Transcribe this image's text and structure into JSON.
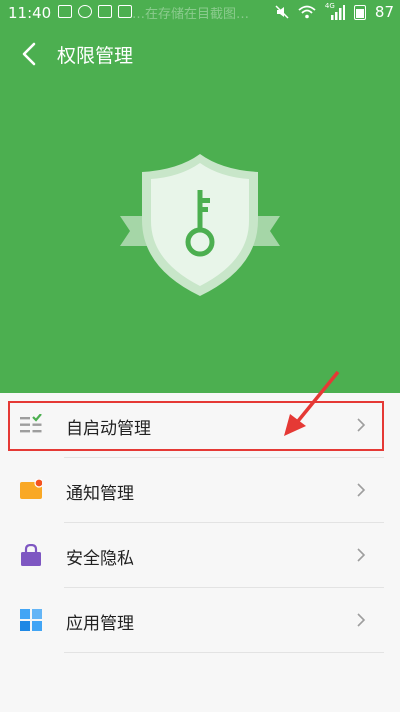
{
  "status_bar": {
    "time": "11:40",
    "ghost_text": "…在存储在目截图…",
    "network": "4G",
    "battery": "87"
  },
  "header": {
    "title": "权限管理",
    "back_icon": "chevron-left-icon"
  },
  "hero": {
    "background_color": "#4caf50",
    "emblem": "shield-key-icon"
  },
  "menu": {
    "items": [
      {
        "label": "自启动管理",
        "icon": "startup-list-icon",
        "highlighted": true
      },
      {
        "label": "通知管理",
        "icon": "notification-icon"
      },
      {
        "label": "安全隐私",
        "icon": "lock-bag-icon"
      },
      {
        "label": "应用管理",
        "icon": "app-grid-icon"
      }
    ]
  },
  "annotation": {
    "color": "#e53935"
  }
}
